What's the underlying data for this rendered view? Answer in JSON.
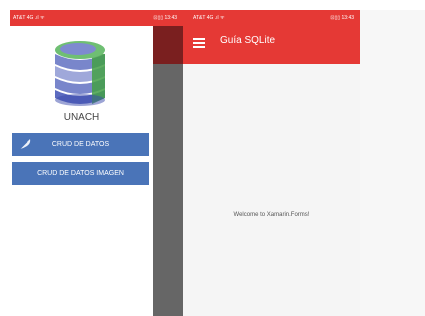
{
  "left_phone": {
    "status": {
      "carrier": "AT&T 4G .ıl ᯤ",
      "time": "⊡▯▯ 13:43"
    },
    "drawer": {
      "title": "UNACH",
      "items": [
        {
          "label": "CRUD DE DATOS",
          "icon": "feather-icon"
        },
        {
          "label": "CRUD DE DATOS IMAGEN"
        }
      ]
    }
  },
  "middle_phone": {
    "status": {
      "carrier": "AT&T 4G .ıl ᯤ",
      "time": "⊡▯▯ 13:43"
    },
    "app_bar": {
      "title": "Guía SQLite",
      "menu_icon": "hamburger-icon"
    },
    "content": {
      "welcome": "Welcome to Xamarin.Forms!"
    }
  },
  "colors": {
    "primary": "#e53935",
    "button": "#4a74b8",
    "overlay": "#666666"
  }
}
